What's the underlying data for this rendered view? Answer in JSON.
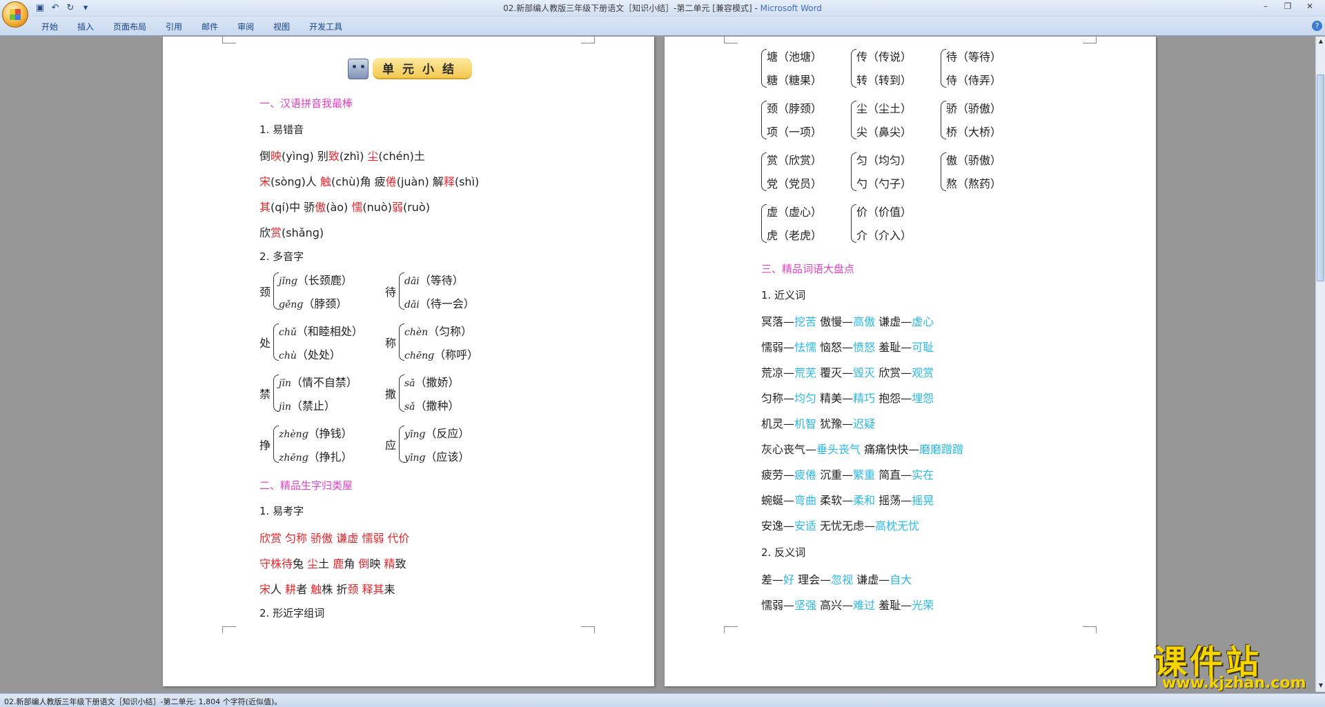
{
  "window": {
    "title": "02.新部编人教版三年级下册语文［知识小结］-第二单元 [兼容模式] - ",
    "app_name": "Microsoft Word",
    "quick_access": [
      "save-icon",
      "undo-icon",
      "redo-icon",
      "customize-icon"
    ]
  },
  "ribbon": {
    "tabs": [
      "开始",
      "插入",
      "页面布局",
      "引用",
      "邮件",
      "审阅",
      "视图",
      "开发工具"
    ]
  },
  "status_bar": "02.新部编人教版三年级下册语文［知识小结］-第二单元: 1,804 个字符(近似值)。",
  "watermark": {
    "main": "课件站",
    "sub": "www.kjzhan.com"
  },
  "page1": {
    "heading": "单元小结",
    "sec1": "一、汉语拼音我最棒",
    "sub1": "1. 易错音",
    "r1": [
      [
        "倒",
        ""
      ],
      [
        "映",
        "red"
      ],
      [
        "(yìng)  别",
        ""
      ],
      [
        "致",
        "red"
      ],
      [
        "(zhì)  ",
        ""
      ],
      [
        "尘",
        "red"
      ],
      [
        "(chén)土",
        ""
      ]
    ],
    "r2": [
      [
        "宋",
        "red"
      ],
      [
        "(sònɡ)人  ",
        ""
      ],
      [
        "触",
        "red"
      ],
      [
        "(chù)角  疲",
        ""
      ],
      [
        "倦",
        "red"
      ],
      [
        "(juàn)  解",
        ""
      ],
      [
        "释",
        "red"
      ],
      [
        "(shì)",
        ""
      ]
    ],
    "r3": [
      [
        "其",
        "red"
      ],
      [
        "(qí)中  骄",
        ""
      ],
      [
        "傲",
        "red"
      ],
      [
        "(ào)  ",
        ""
      ],
      [
        "懦",
        "red"
      ],
      [
        "(nuò)",
        ""
      ],
      [
        "弱",
        "red"
      ],
      [
        "(ruò)",
        ""
      ]
    ],
    "r4": [
      [
        "欣",
        ""
      ],
      [
        "赏",
        "red"
      ],
      [
        "(shǎnɡ)",
        ""
      ]
    ],
    "sub2": "2. 多音字",
    "poly": [
      {
        "ch": "颈",
        "a": [
          "jǐnɡ",
          "（长颈鹿）"
        ],
        "b": [
          "ɡěnɡ",
          "（脖颈）"
        ]
      },
      {
        "ch": "待",
        "a": [
          "dāi",
          "（等待）"
        ],
        "b": [
          "dāi",
          "（待一会）"
        ]
      },
      {
        "ch": "处",
        "a": [
          "chǔ",
          "（和睦相处）"
        ],
        "b": [
          "chù",
          "（处处）"
        ]
      },
      {
        "ch": "称",
        "a": [
          "chèn",
          "（匀称）"
        ],
        "b": [
          "chēnɡ",
          "（称呼）"
        ]
      },
      {
        "ch": "禁",
        "a": [
          "jīn",
          "（情不自禁）"
        ],
        "b": [
          "jìn",
          "（禁止）"
        ]
      },
      {
        "ch": "撒",
        "a": [
          "sā",
          "（撒娇）"
        ],
        "b": [
          "sǎ",
          "（撒种）"
        ]
      },
      {
        "ch": "挣",
        "a": [
          "zhènɡ",
          "（挣钱）"
        ],
        "b": [
          "zhēnɡ",
          "（挣扎）"
        ]
      },
      {
        "ch": "应",
        "a": [
          "yīnɡ",
          "（反应）"
        ],
        "b": [
          "yīnɡ",
          "（应该）"
        ]
      }
    ],
    "sec2": "二、精品生字归类屋",
    "sub3": "1. 易考字",
    "k1": [
      [
        "欣赏  匀称  骄傲  谦虚  懦弱  代价",
        "red"
      ]
    ],
    "k2": [
      [
        "守株待",
        "red"
      ],
      [
        "兔  ",
        ""
      ],
      [
        "尘",
        "red"
      ],
      [
        "土  ",
        ""
      ],
      [
        "鹿",
        "red"
      ],
      [
        "角  ",
        ""
      ],
      [
        "倒",
        "red"
      ],
      [
        "映  ",
        ""
      ],
      [
        "精",
        "red"
      ],
      [
        "致",
        ""
      ]
    ],
    "k3": [
      [
        "宋",
        "red"
      ],
      [
        "人  ",
        ""
      ],
      [
        "耕",
        "red"
      ],
      [
        "者  ",
        ""
      ],
      [
        "触",
        "red"
      ],
      [
        "株  折",
        ""
      ],
      [
        "颈",
        "red"
      ],
      [
        "  ",
        ""
      ],
      [
        "释其",
        "red"
      ],
      [
        "耒",
        ""
      ]
    ],
    "sub4": "2. 形近字组词"
  },
  "page2": {
    "groups": [
      [
        [
          "塘（池塘）",
          "糖（糖果）"
        ],
        [
          "传（传说）",
          "转（转到）"
        ],
        [
          "待（等待）",
          "侍（侍弄）"
        ]
      ],
      [
        [
          "颈（脖颈）",
          "项（一项）"
        ],
        [
          "尘（尘土）",
          "尖（鼻尖）"
        ],
        [
          "骄（骄傲）",
          "桥（大桥）"
        ]
      ],
      [
        [
          "赏（欣赏）",
          "党（党员）"
        ],
        [
          "匀（均匀）",
          "勺（勺子）"
        ],
        [
          "傲（骄傲）",
          "熬（熬药）"
        ]
      ],
      [
        [
          "虚（虚心）",
          "虎（老虎）"
        ],
        [
          "价（价值）",
          "介（介入）"
        ]
      ]
    ],
    "sec3": "三、精品词语大盘点",
    "sub1": "1. 近义词",
    "syn": [
      [
        [
          "冥落—",
          ""
        ],
        [
          "挖苦",
          "cyan"
        ],
        [
          "  傲慢—",
          ""
        ],
        [
          "高傲",
          "cyan"
        ],
        [
          "  谦虚—",
          ""
        ],
        [
          "虚心",
          "cyan"
        ]
      ],
      [
        [
          "懦弱—",
          ""
        ],
        [
          "怯懦",
          "cyan"
        ],
        [
          "  恼怒—",
          ""
        ],
        [
          "愤怒",
          "cyan"
        ],
        [
          "  羞耻—",
          ""
        ],
        [
          "可耻",
          "cyan"
        ]
      ],
      [
        [
          "荒凉—",
          ""
        ],
        [
          "荒芜",
          "cyan"
        ],
        [
          "  覆灭—",
          ""
        ],
        [
          "毁灭",
          "cyan"
        ],
        [
          "  欣赏—",
          ""
        ],
        [
          "观赏",
          "cyan"
        ]
      ],
      [
        [
          "匀称—",
          ""
        ],
        [
          "均匀",
          "cyan"
        ],
        [
          "  精美—",
          ""
        ],
        [
          "精巧",
          "cyan"
        ],
        [
          "  抱怨—",
          ""
        ],
        [
          "埋怨",
          "cyan"
        ]
      ],
      [
        [
          "机灵—",
          ""
        ],
        [
          "机智",
          "cyan"
        ],
        [
          "  犹豫—",
          ""
        ],
        [
          "迟疑",
          "cyan"
        ]
      ],
      [
        [
          "灰心丧气—",
          ""
        ],
        [
          "垂头丧气",
          "cyan"
        ],
        [
          "  痛痛快快—",
          ""
        ],
        [
          "磨磨蹭蹭",
          "cyan"
        ]
      ],
      [
        [
          "疲劳—",
          ""
        ],
        [
          "疲倦",
          "cyan"
        ],
        [
          "  沉重—",
          ""
        ],
        [
          "繁重",
          "cyan"
        ],
        [
          "  简直—",
          ""
        ],
        [
          "实在",
          "cyan"
        ]
      ],
      [
        [
          "蜿蜒—",
          ""
        ],
        [
          "弯曲",
          "cyan"
        ],
        [
          "  柔软—",
          ""
        ],
        [
          "柔和",
          "cyan"
        ],
        [
          "  摇荡—",
          ""
        ],
        [
          "摇晃",
          "cyan"
        ]
      ],
      [
        [
          "安逸—",
          ""
        ],
        [
          "安适",
          "cyan"
        ],
        [
          "  无忧无虑—",
          ""
        ],
        [
          "高枕无忧",
          "cyan"
        ]
      ]
    ],
    "sub2": "2. 反义词",
    "ant": [
      [
        [
          "差—",
          ""
        ],
        [
          "好",
          "cyan"
        ],
        [
          "  理会—",
          ""
        ],
        [
          "忽视",
          "cyan"
        ],
        [
          "  谦虚—",
          ""
        ],
        [
          "自大",
          "cyan"
        ]
      ],
      [
        [
          "懦弱—",
          ""
        ],
        [
          "坚强",
          "cyan"
        ],
        [
          "  高兴—",
          ""
        ],
        [
          "难过",
          "cyan"
        ],
        [
          "  羞耻—",
          ""
        ],
        [
          "光荣",
          "cyan"
        ]
      ]
    ]
  }
}
